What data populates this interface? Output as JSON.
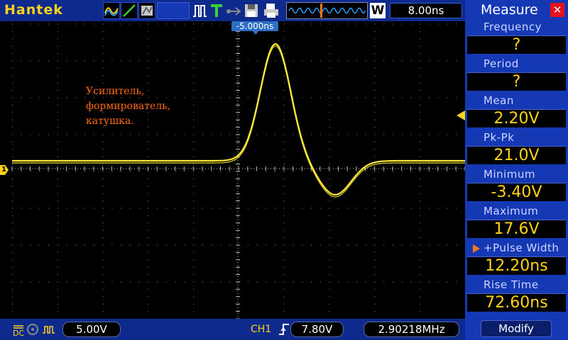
{
  "header": {
    "brand": "Hantek",
    "timebase": "8.00ns",
    "zoom_label": "W"
  },
  "screen": {
    "trigger_time_offset": "-5.000ns",
    "annotation_lines": [
      "Усилитель,",
      "формирователь,",
      "катушка."
    ],
    "channel_marker": "1",
    "trace_color": "#ffe83a"
  },
  "footer": {
    "volts_per_div": "5.00V",
    "trigger_channel": "CH1",
    "trigger_level": "7.80V",
    "frequency_counter": "2.90218MHz"
  },
  "measure_panel": {
    "title": "Measure",
    "measurements": [
      {
        "label": "Frequency",
        "value": "?"
      },
      {
        "label": "Period",
        "value": "?"
      },
      {
        "label": "Mean",
        "value": "2.20V"
      },
      {
        "label": "Pk-Pk",
        "value": "21.0V"
      },
      {
        "label": "Minimum",
        "value": "-3.40V"
      },
      {
        "label": "Maximum",
        "value": "17.6V"
      },
      {
        "label": "+Pulse Width",
        "value": "12.20ns"
      },
      {
        "label": "Rise Time",
        "value": "72.60ns"
      }
    ],
    "modify_label": "Modify"
  },
  "colors": {
    "bar_blue": "#0d2a8c",
    "panel_blue": "#1538b5",
    "accent_yellow": "#ffd21a",
    "accent_orange": "#ff7a1a"
  }
}
